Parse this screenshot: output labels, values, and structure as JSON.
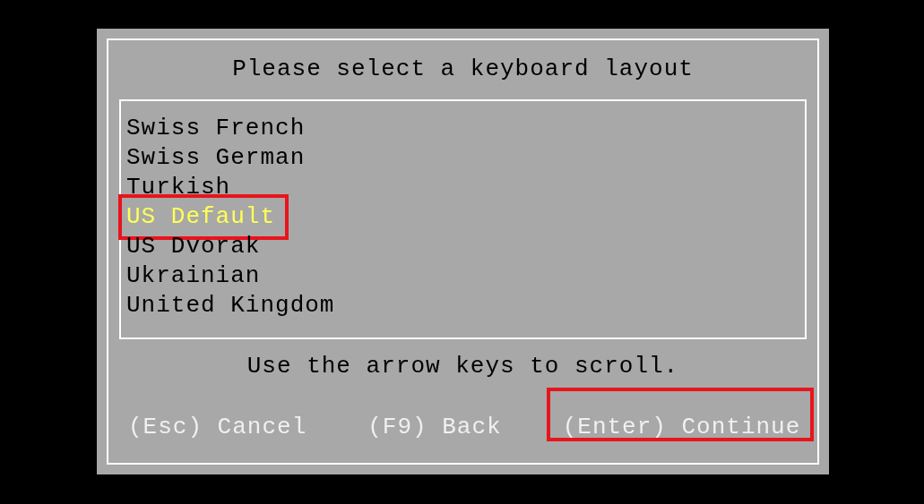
{
  "dialog": {
    "title": "Please select a keyboard layout",
    "layouts": [
      {
        "label": "Swiss French",
        "selected": false,
        "highlighted": false
      },
      {
        "label": "Swiss German",
        "selected": false,
        "highlighted": false
      },
      {
        "label": "Turkish",
        "selected": false,
        "highlighted": false
      },
      {
        "label": "US Default",
        "selected": true,
        "highlighted": true
      },
      {
        "label": "US Dvorak",
        "selected": false,
        "highlighted": false
      },
      {
        "label": "Ukrainian",
        "selected": false,
        "highlighted": false
      },
      {
        "label": "United Kingdom",
        "selected": false,
        "highlighted": false
      }
    ],
    "hint": "Use the arrow keys to scroll.",
    "actions": [
      {
        "label": "(Esc) Cancel",
        "highlighted": false
      },
      {
        "label": "(F9) Back",
        "highlighted": false
      },
      {
        "label": "(Enter) Continue",
        "highlighted": true
      }
    ]
  }
}
